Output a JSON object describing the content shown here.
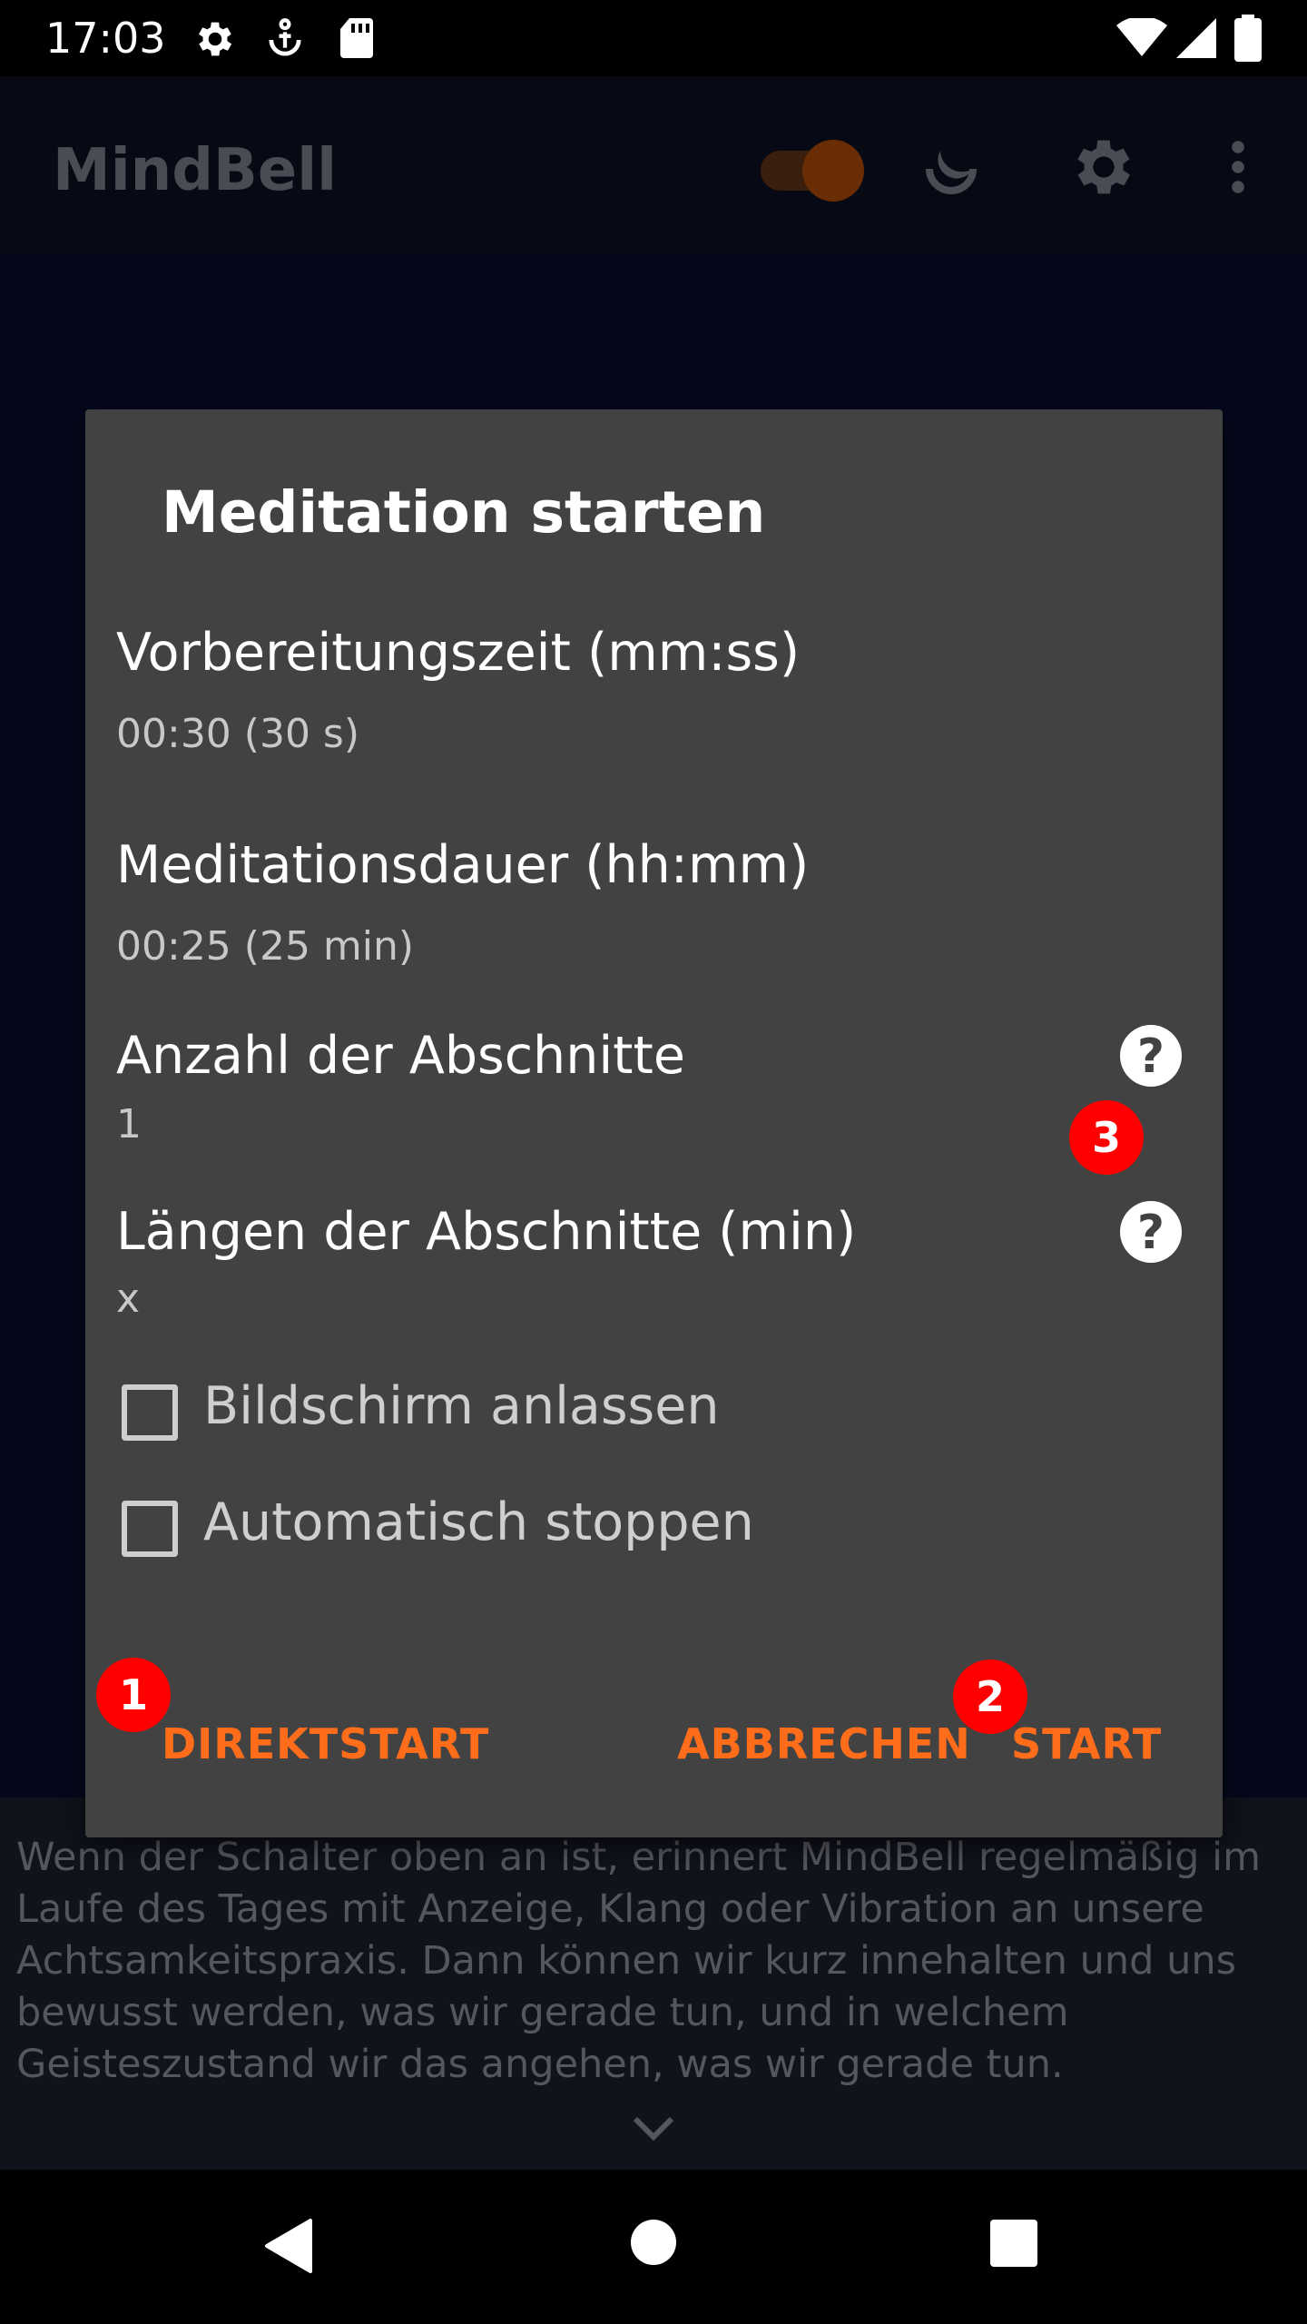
{
  "status_bar": {
    "time": "17:03",
    "left_icons": [
      "settings-icon",
      "accessibility-icon",
      "sd-card-icon"
    ],
    "right_icons": [
      "wifi-icon",
      "signal-icon",
      "battery-icon"
    ]
  },
  "app_bar": {
    "title": "MindBell",
    "toggle_state": "on",
    "actions": [
      "meditation-icon",
      "settings-gear-icon",
      "overflow-menu-icon"
    ]
  },
  "dialog": {
    "title": "Meditation starten",
    "preferences": [
      {
        "title": "Vorbereitungszeit (mm:ss)",
        "summary": "00:30 (30 s)"
      },
      {
        "title": "Meditationsdauer (hh:mm)",
        "summary": "00:25 (25 min)"
      },
      {
        "title": "Anzahl der Abschnitte",
        "summary": "1",
        "help_icon": "question-circle-icon"
      },
      {
        "title": "Längen der Abschnitte (min)",
        "summary": "x",
        "help_icon": "question-circle-icon"
      }
    ],
    "checkboxes": [
      {
        "label": "Bildschirm anlassen",
        "checked": false
      },
      {
        "label": "Automatisch stoppen",
        "checked": false
      }
    ],
    "buttons": {
      "direct_start": "DIREKTSTART",
      "cancel": "ABBRECHEN",
      "start": "START"
    },
    "accent_color": "#ff6d1a"
  },
  "markers": [
    "1",
    "2",
    "3"
  ],
  "info_text": "Wenn der Schalter oben an ist, erinnert MindBell regelmäßig im Laufe des Tages mit Anzeige, Klang oder Vibration an unsere Achtsamkeitspraxis. Dann können wir kurz innehalten und uns bewusst werden, was wir gerade tun, und in welchem Geisteszustand wir das angehen, was wir gerade tun.",
  "nav_bar": [
    "back-icon",
    "home-icon",
    "recents-icon"
  ]
}
